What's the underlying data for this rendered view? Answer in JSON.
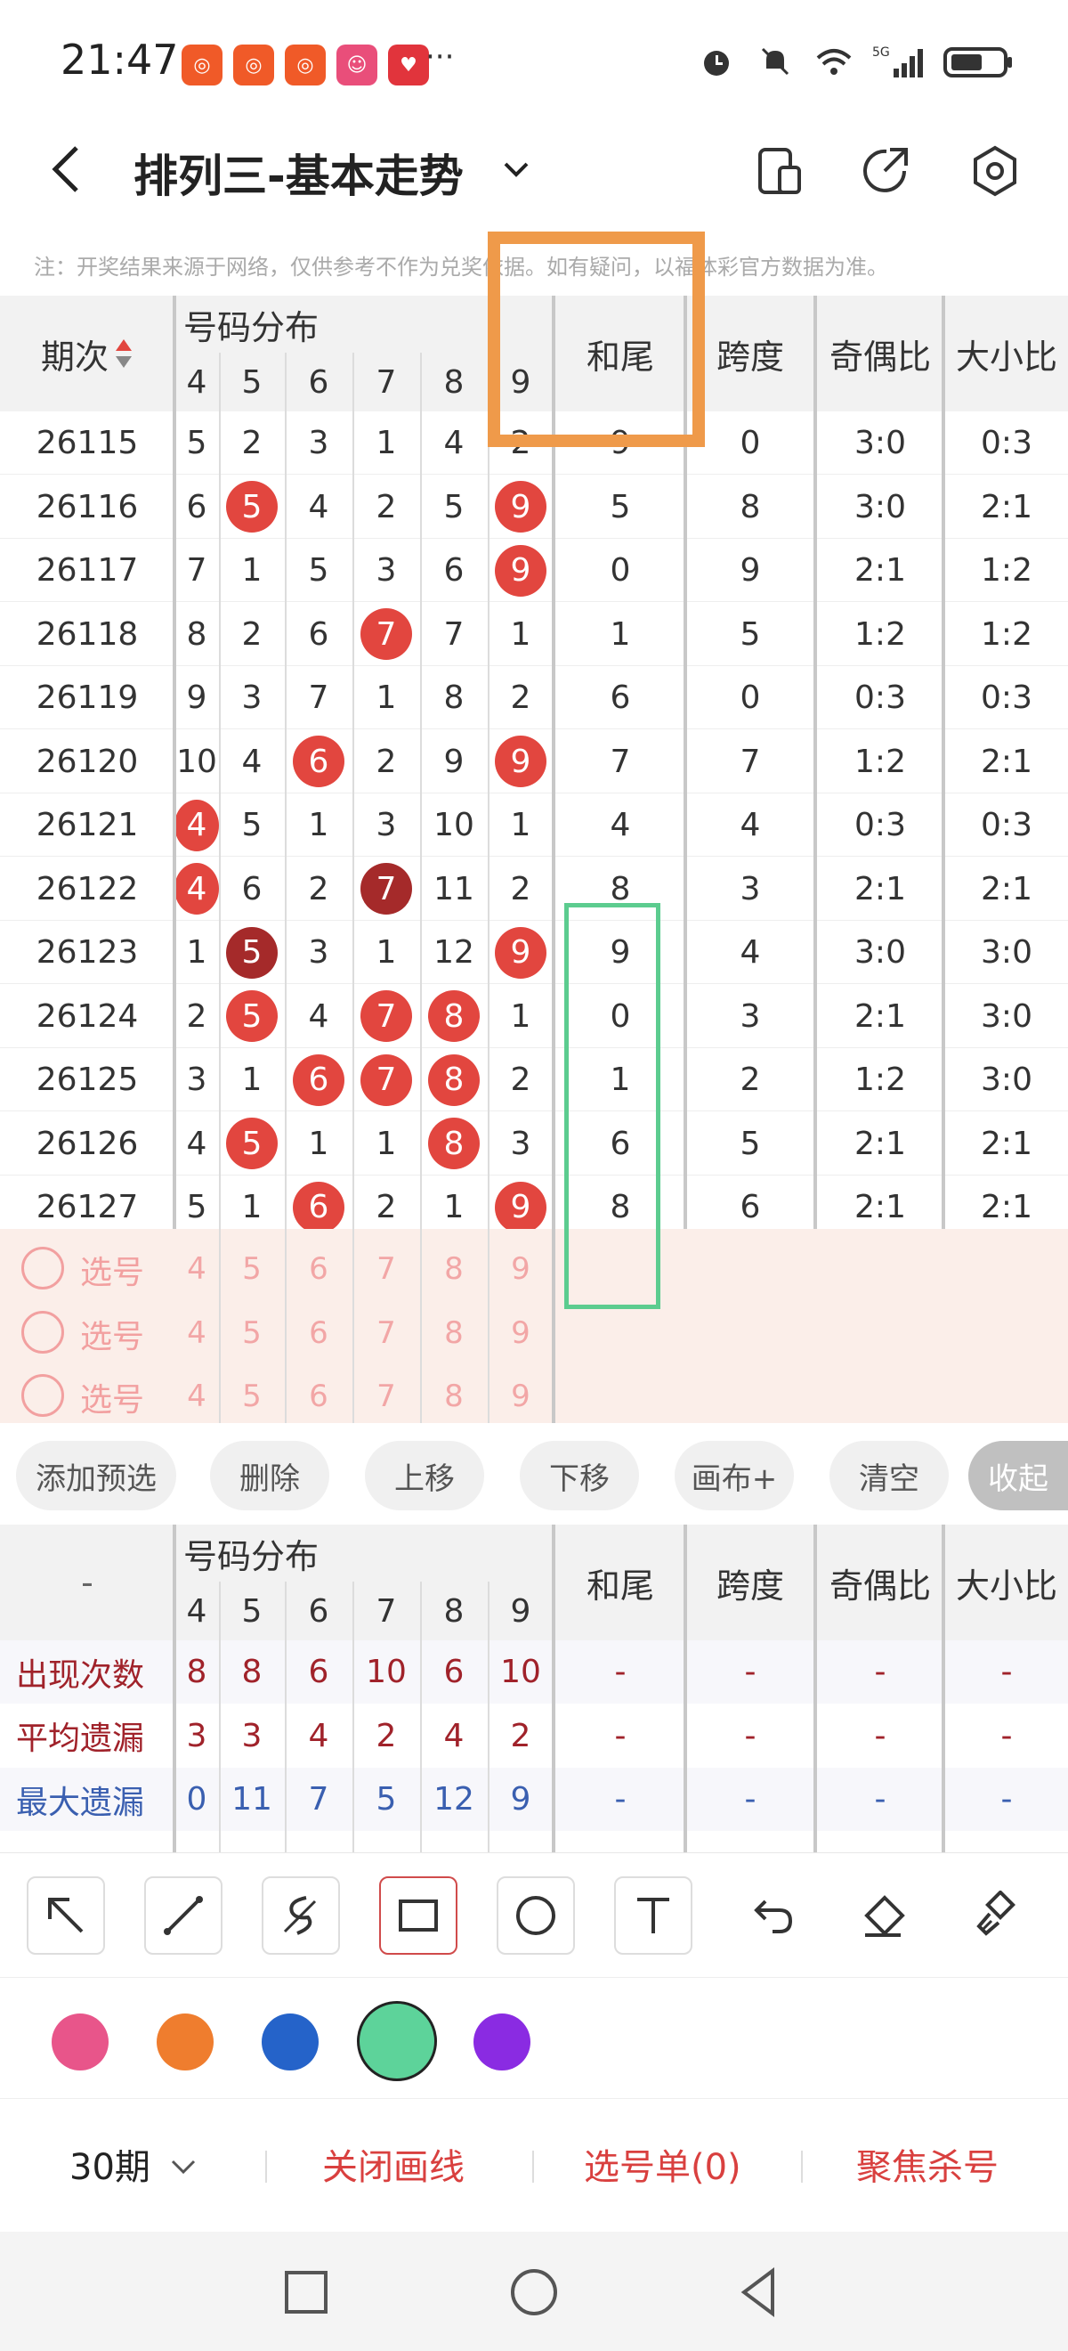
{
  "status": {
    "time": "21:47",
    "more": "···",
    "signal_label": "5G"
  },
  "header": {
    "title": "排列三-基本走势"
  },
  "notice": "注：开奖结果来源于网络，仅供参考不作为兑奖依据。如有疑问，以福体彩官方数据为准。",
  "table": {
    "period_header": "期次",
    "dist_header": "号码分布",
    "digit_headers": [
      "4",
      "5",
      "6",
      "7",
      "8",
      "9"
    ],
    "col_headers": [
      "和尾",
      "跨度",
      "奇偶比",
      "大小比"
    ],
    "rows": [
      {
        "period": "26115",
        "digits": [
          "5",
          "2",
          "3",
          "1",
          "4",
          "2"
        ],
        "balls": [],
        "hewei": "9",
        "kuadu": "0",
        "jiou": "3:0",
        "daxiao": "0:3"
      },
      {
        "period": "26116",
        "digits": [
          "6",
          "5",
          "4",
          "2",
          "5",
          "9"
        ],
        "balls": [
          1,
          5
        ],
        "hewei": "5",
        "kuadu": "8",
        "jiou": "3:0",
        "daxiao": "2:1"
      },
      {
        "period": "26117",
        "digits": [
          "7",
          "1",
          "5",
          "3",
          "6",
          "9"
        ],
        "balls": [
          5
        ],
        "hewei": "0",
        "kuadu": "9",
        "jiou": "2:1",
        "daxiao": "1:2"
      },
      {
        "period": "26118",
        "digits": [
          "8",
          "2",
          "6",
          "7",
          "7",
          "1"
        ],
        "balls": [
          3
        ],
        "hewei": "1",
        "kuadu": "5",
        "jiou": "1:2",
        "daxiao": "1:2"
      },
      {
        "period": "26119",
        "digits": [
          "9",
          "3",
          "7",
          "1",
          "8",
          "2"
        ],
        "balls": [],
        "hewei": "6",
        "kuadu": "0",
        "jiou": "0:3",
        "daxiao": "0:3"
      },
      {
        "period": "26120",
        "digits": [
          "10",
          "4",
          "6",
          "2",
          "9",
          "9"
        ],
        "balls": [
          2,
          5
        ],
        "hewei": "7",
        "kuadu": "7",
        "jiou": "1:2",
        "daxiao": "2:1"
      },
      {
        "period": "26121",
        "digits": [
          "4",
          "5",
          "1",
          "3",
          "10",
          "1"
        ],
        "balls": [
          0
        ],
        "hewei": "4",
        "kuadu": "4",
        "jiou": "0:3",
        "daxiao": "0:3"
      },
      {
        "period": "26122",
        "digits": [
          "4",
          "6",
          "2",
          "7",
          "11",
          "2"
        ],
        "balls": [
          0,
          3
        ],
        "dark": [
          3
        ],
        "hewei": "8",
        "kuadu": "3",
        "jiou": "2:1",
        "daxiao": "2:1"
      },
      {
        "period": "26123",
        "digits": [
          "1",
          "5",
          "3",
          "1",
          "12",
          "9"
        ],
        "balls": [
          1,
          5
        ],
        "dark": [
          1
        ],
        "hewei": "9",
        "kuadu": "4",
        "jiou": "3:0",
        "daxiao": "3:0"
      },
      {
        "period": "26124",
        "digits": [
          "2",
          "5",
          "4",
          "7",
          "8",
          "1"
        ],
        "balls": [
          1,
          3,
          4
        ],
        "hewei": "0",
        "kuadu": "3",
        "jiou": "2:1",
        "daxiao": "3:0"
      },
      {
        "period": "26125",
        "digits": [
          "3",
          "1",
          "6",
          "7",
          "8",
          "2"
        ],
        "balls": [
          2,
          3,
          4
        ],
        "hewei": "1",
        "kuadu": "2",
        "jiou": "1:2",
        "daxiao": "3:0"
      },
      {
        "period": "26126",
        "digits": [
          "4",
          "5",
          "1",
          "1",
          "8",
          "3"
        ],
        "balls": [
          1,
          4
        ],
        "hewei": "6",
        "kuadu": "5",
        "jiou": "2:1",
        "daxiao": "2:1"
      },
      {
        "period": "26127",
        "digits": [
          "5",
          "1",
          "6",
          "2",
          "1",
          "9"
        ],
        "balls": [
          2,
          5
        ],
        "hewei": "8",
        "kuadu": "6",
        "jiou": "2:1",
        "daxiao": "2:1"
      }
    ],
    "pick_label": "选号",
    "pick_digits": [
      "4",
      "5",
      "6",
      "7",
      "8",
      "9"
    ]
  },
  "actions": [
    "添加预选",
    "删除",
    "上移",
    "下移",
    "画布+",
    "清空",
    "收起"
  ],
  "stats": {
    "dash": "-",
    "dist_header": "号码分布",
    "digit_headers": [
      "4",
      "5",
      "6",
      "7",
      "8",
      "9"
    ],
    "col_headers": [
      "和尾",
      "跨度",
      "奇偶比",
      "大小比"
    ],
    "rows": [
      {
        "label": "出现次数",
        "color": "#a0222a",
        "values": [
          "8",
          "8",
          "6",
          "10",
          "6",
          "10"
        ]
      },
      {
        "label": "平均遗漏",
        "color": "#a0222a",
        "values": [
          "3",
          "3",
          "4",
          "2",
          "4",
          "2"
        ]
      },
      {
        "label": "最大遗漏",
        "color": "#3a5fb0",
        "values": [
          "0",
          "11",
          "7",
          "5",
          "12",
          "9"
        ]
      }
    ]
  },
  "colors": {
    "swatches": [
      "#e8558a",
      "#ef7d2e",
      "#2563c9",
      "#5dd39a",
      "#8a2be2"
    ],
    "orange_box": "#ef9a4a",
    "green_box": "#5ccc8f",
    "accent_red": "#d9403f"
  },
  "bottom": {
    "periods": "30期",
    "close_draw": "关闭画线",
    "pick_list": "选号单(0)",
    "focus_kill": "聚焦杀号"
  }
}
